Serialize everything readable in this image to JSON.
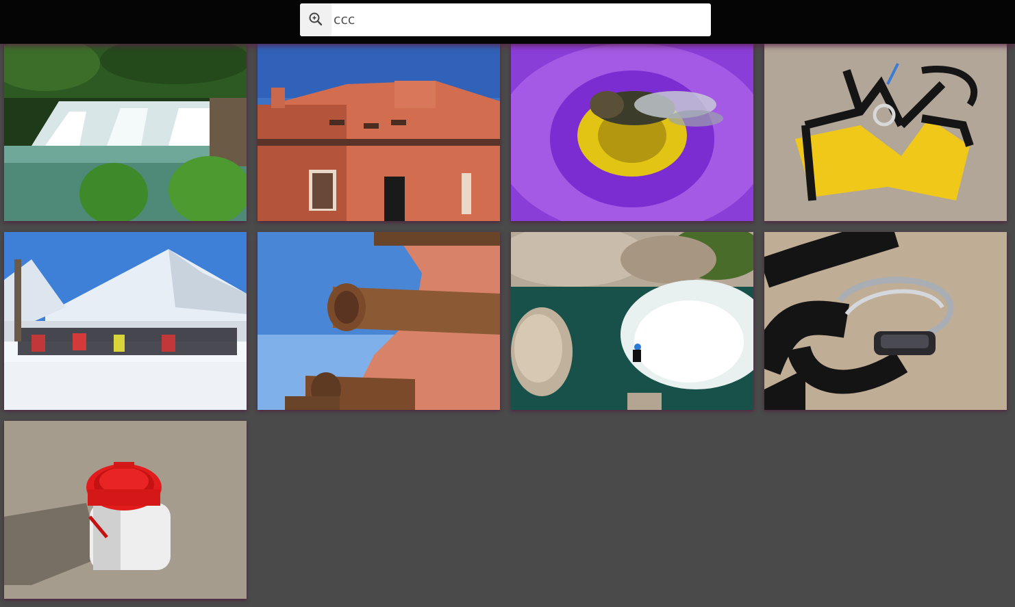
{
  "search": {
    "value": "ccc",
    "icon": "zoom-search-icon"
  },
  "photos": [
    {
      "subject": "waterfall"
    },
    {
      "subject": "adobe-building"
    },
    {
      "subject": "fly-on-purple-flower"
    },
    {
      "subject": "yellow-climbing-harness"
    },
    {
      "subject": "snow-mountain-group"
    },
    {
      "subject": "adobe-wooden-beams"
    },
    {
      "subject": "canyon-river-swimmer"
    },
    {
      "subject": "carabiners-on-gravel"
    },
    {
      "subject": "red-white-container"
    }
  ]
}
